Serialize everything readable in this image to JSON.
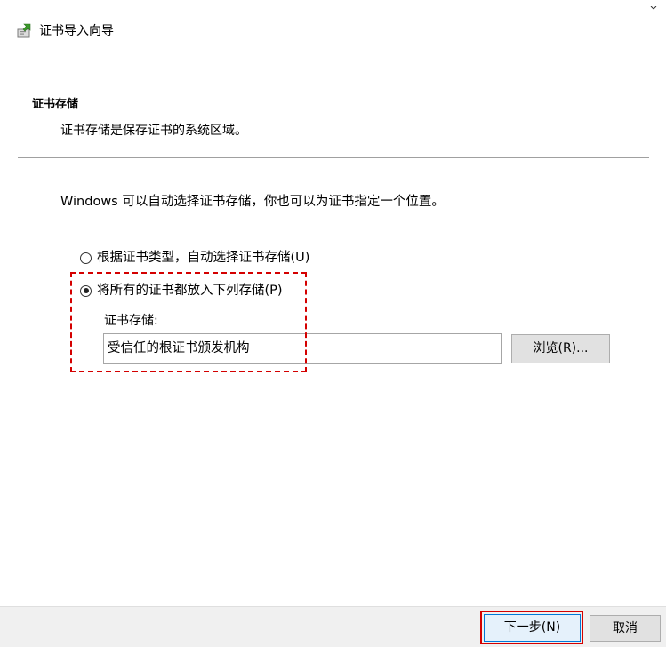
{
  "window": {
    "title": "证书导入向导",
    "icon": "certificate-wizard-icon"
  },
  "header": {
    "title": "证书存储",
    "description": "证书存储是保存证书的系统区域。"
  },
  "main": {
    "intro": "Windows 可以自动选择证书存储，你也可以为证书指定一个位置。",
    "options": [
      {
        "label": "根据证书类型，自动选择证书存储(U)",
        "checked": false
      },
      {
        "label": "将所有的证书都放入下列存储(P)",
        "checked": true
      }
    ],
    "store_label": "证书存储:",
    "store_value": "受信任的根证书颁发机构",
    "browse_label": "浏览(R)..."
  },
  "footer": {
    "next_label": "下一步(N)",
    "cancel_label": "取消"
  },
  "colors": {
    "highlight": "#d40000",
    "focus_border": "#0078d7",
    "footer_bg": "#f0f0f0"
  }
}
